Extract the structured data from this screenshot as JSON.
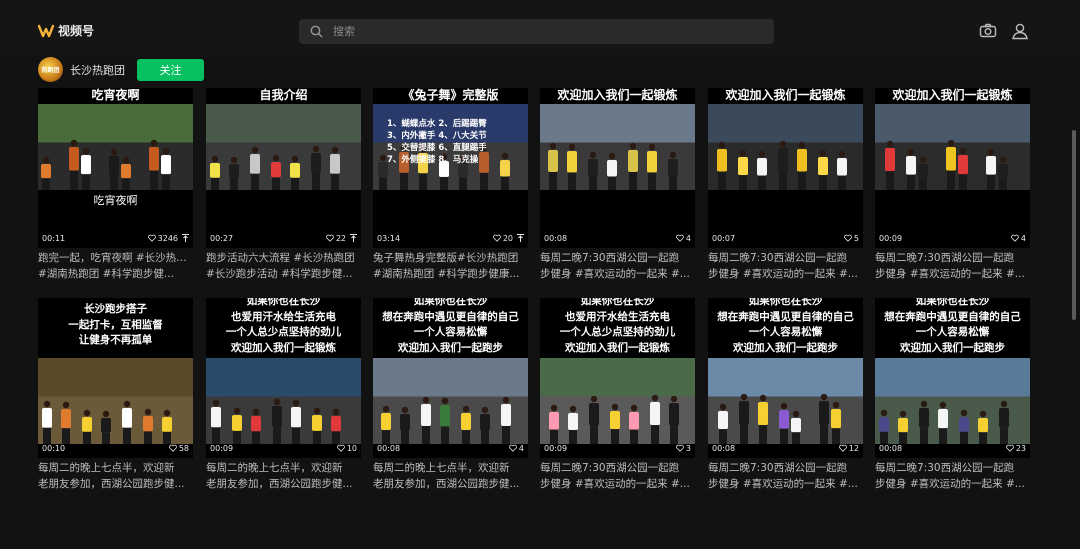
{
  "app": {
    "title": "视频号"
  },
  "search": {
    "placeholder": "搜索"
  },
  "account": {
    "name": "长沙热跑团",
    "avatar_text": "热跑团",
    "follow_label": "关注"
  },
  "colors": {
    "accent": "#07c160",
    "logo": "#f7b23b",
    "background": "#121212"
  },
  "videos": [
    {
      "duration": "00:11",
      "likes": "3246",
      "has_extra": true,
      "title_lines": [
        "吃宵夜啊"
      ],
      "subtitle": "吃宵夜啊",
      "caption": [
        "跑完一起，吃宵夜啊 #长沙热跑团",
        "#湖南热跑团 #科学跑步健..."
      ]
    },
    {
      "duration": "00:27",
      "likes": "22",
      "has_extra": true,
      "title_lines": [
        "自我介绍"
      ],
      "subtitle": "",
      "caption": [
        "跑步活动六大流程 #长沙热跑团",
        "#长沙跑步活动 #科学跑步健..."
      ]
    },
    {
      "duration": "03:14",
      "likes": "20",
      "has_extra": true,
      "title_lines": [
        "《兔子舞》完整版"
      ],
      "subtitle": "",
      "list": [
        "1、蝴蝶点水 2、后踢踢臀",
        "3、内外撇手 4、八大关节",
        "5、交替提膝 6、直腿踢手",
        "7、外侧提膝 8、马克操"
      ],
      "caption": [
        "兔子舞热身完整版#长沙热跑团",
        "#湖南热跑团 #科学跑步健康..."
      ]
    },
    {
      "duration": "00:08",
      "likes": "4",
      "has_extra": false,
      "title_lines": [
        "欢迎加入我们一起锻炼"
      ],
      "subtitle": "",
      "caption": [
        "每周二晚7:30西湖公园一起跑",
        "步健身 #喜欢运动的一起来 #..."
      ]
    },
    {
      "duration": "00:07",
      "likes": "5",
      "has_extra": false,
      "title_lines": [
        "欢迎加入我们一起锻炼"
      ],
      "subtitle": "",
      "caption": [
        "每周二晚7:30西湖公园一起跑",
        "步健身 #喜欢运动的一起来 #..."
      ]
    },
    {
      "duration": "00:09",
      "likes": "4",
      "has_extra": false,
      "title_lines": [
        "欢迎加入我们一起锻炼"
      ],
      "subtitle": "",
      "caption": [
        "每周二晚7:30西湖公园一起跑",
        "步健身 #喜欢运动的一起来 #..."
      ]
    },
    {
      "duration": "00:10",
      "likes": "58",
      "has_extra": false,
      "title_lines": [
        "长沙跑步搭子",
        "一起打卡，互相监督",
        "让健身不再孤单"
      ],
      "subtitle": "",
      "caption": [
        "每周二的晚上七点半，欢迎新",
        "老朋友参加，西湖公园跑步健..."
      ]
    },
    {
      "duration": "00:09",
      "likes": "10",
      "has_extra": false,
      "title_lines": [
        "如果你也在长沙",
        "也爱用汗水给生活充电",
        "一个人总少点坚持的劲儿",
        "欢迎加入我们一起锻炼"
      ],
      "subtitle": "",
      "caption": [
        "每周二的晚上七点半，欢迎新",
        "老朋友参加，西湖公园跑步健..."
      ]
    },
    {
      "duration": "00:08",
      "likes": "4",
      "has_extra": false,
      "title_lines": [
        "如果你也在长沙",
        "想在奔跑中遇见更自律的自己",
        "一个人容易松懈",
        "欢迎加入我们一起跑步"
      ],
      "subtitle": "",
      "caption": [
        "每周二的晚上七点半，欢迎新",
        "老朋友参加，西湖公园跑步健..."
      ]
    },
    {
      "duration": "00:09",
      "likes": "3",
      "has_extra": false,
      "title_lines": [
        "如果你也在长沙",
        "也爱用汗水给生活充电",
        "一个人总少点坚持的劲儿",
        "欢迎加入我们一起锻炼"
      ],
      "subtitle": "",
      "caption": [
        "每周二晚7:30西湖公园一起跑",
        "步健身 #喜欢运动的一起来 #..."
      ]
    },
    {
      "duration": "00:08",
      "likes": "12",
      "has_extra": false,
      "title_lines": [
        "如果你也在长沙",
        "想在奔跑中遇见更自律的自己",
        "一个人容易松懈",
        "欢迎加入我们一起跑步"
      ],
      "subtitle": "",
      "caption": [
        "每周二晚7:30西湖公园一起跑",
        "步健身 #喜欢运动的一起来 #..."
      ]
    },
    {
      "duration": "00:08",
      "likes": "23",
      "has_extra": false,
      "title_lines": [
        "如果你也在长沙",
        "想在奔跑中遇见更自律的自己",
        "一个人容易松懈",
        "欢迎加入我们一起跑步"
      ],
      "subtitle": "",
      "caption": [
        "每周二晚7:30西湖公园一起跑",
        "步健身 #喜欢运动的一起来 #..."
      ]
    }
  ]
}
